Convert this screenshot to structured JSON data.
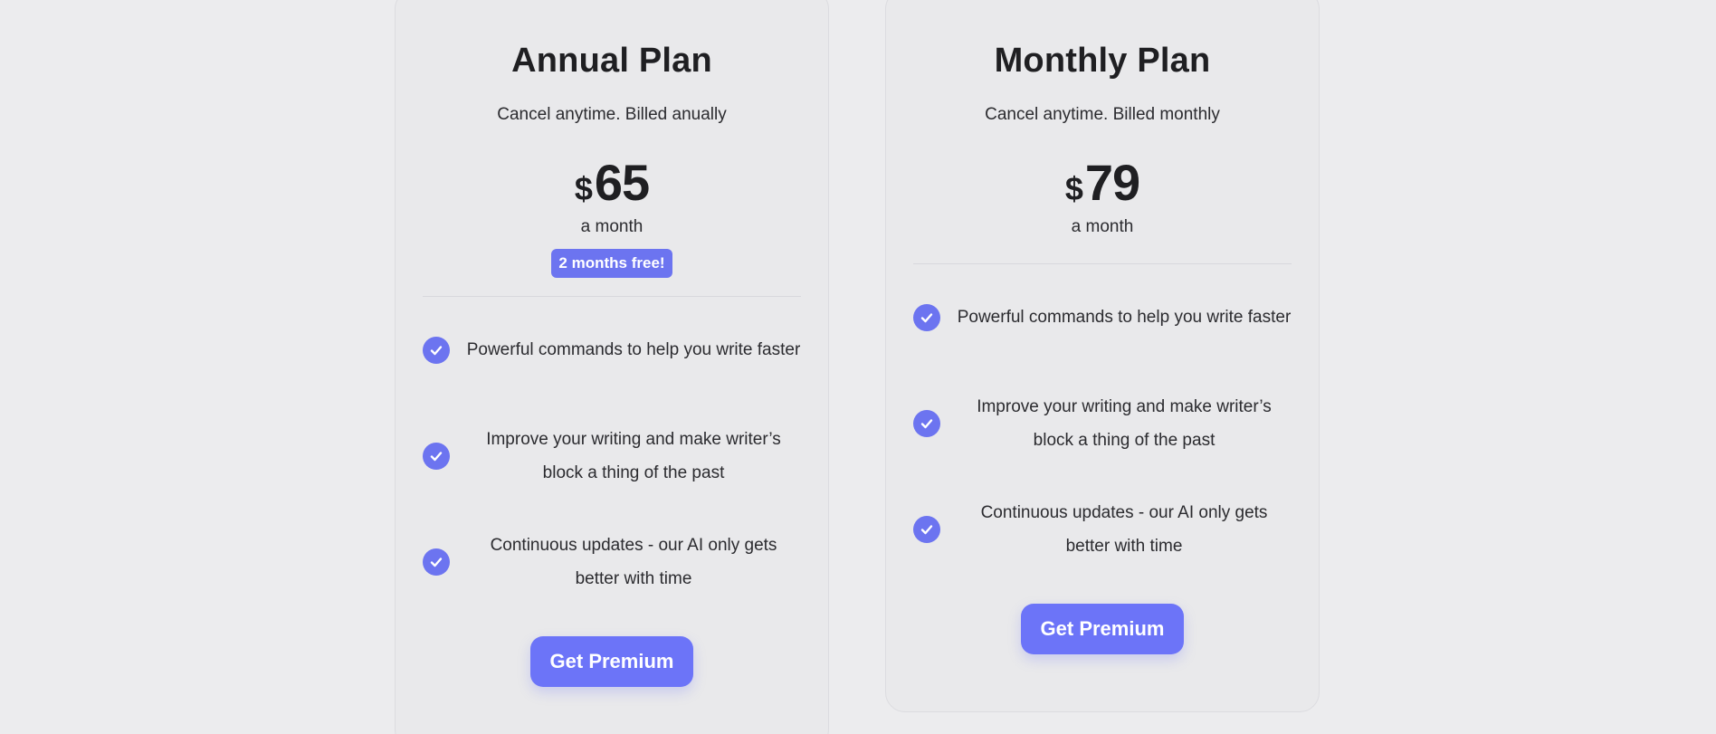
{
  "plans": {
    "annual": {
      "title": "Annual Plan",
      "subtitle": "Cancel anytime. Billed anually",
      "currency": "$",
      "price": "65",
      "period": "a month",
      "badge": "2 months free!",
      "features": [
        "Powerful commands to help you write faster",
        "Improve your writing and make writer’s block a thing of the past",
        "Continuous updates - our AI only gets better with time"
      ],
      "cta_label": "Get Premium"
    },
    "monthly": {
      "title": "Monthly Plan",
      "subtitle": "Cancel anytime. Billed monthly",
      "currency": "$",
      "price": "79",
      "period": "a month",
      "features": [
        "Powerful commands to help you write faster",
        "Improve your writing and make writer’s block a thing of the past",
        "Continuous updates - our AI only gets better with time"
      ],
      "cta_label": "Get Premium"
    }
  },
  "icons": {
    "feature_check": "check-circle-icon"
  },
  "colors": {
    "accent": "#6c74f0",
    "background": "#ececee",
    "card": "#e9e9eb",
    "text": "#1f1f22"
  }
}
